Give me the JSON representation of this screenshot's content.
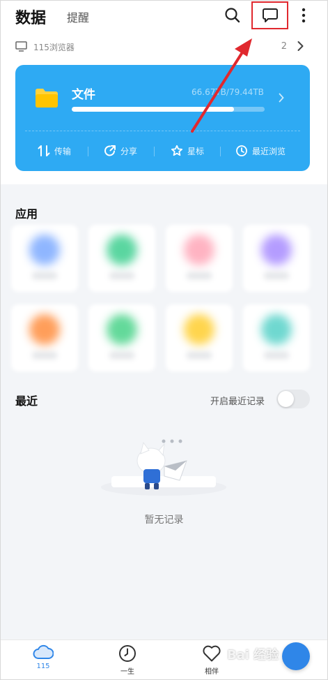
{
  "header": {
    "title": "数据",
    "tab_alerts": "提醒"
  },
  "device": {
    "name": "115浏览器",
    "count": "2"
  },
  "files_card": {
    "title": "文件",
    "storage": "66.67TB/79.44TB",
    "usage_fraction": 0.84,
    "actions": [
      "传输",
      "分享",
      "星标",
      "最近浏览"
    ]
  },
  "apps_section": {
    "title": "应用",
    "dot_colors": [
      "#8fb6ff",
      "#5ad6a0",
      "#ffb3c2",
      "#b49cff",
      "#ff9e5a",
      "#63d99a",
      "#ffd54d",
      "#6fd8d0"
    ]
  },
  "recent_section": {
    "title": "最近",
    "toggle_label": "开启最近记录",
    "toggle_on": false,
    "empty_text": "暂无记录"
  },
  "bottom_nav": {
    "items": [
      "115",
      "一生",
      "相伴"
    ],
    "active": "115"
  },
  "watermark": "Bai 经验",
  "colors": {
    "accent": "#2eaaf3",
    "nav_active": "#2f86e8",
    "annotation": "#e0282e"
  }
}
